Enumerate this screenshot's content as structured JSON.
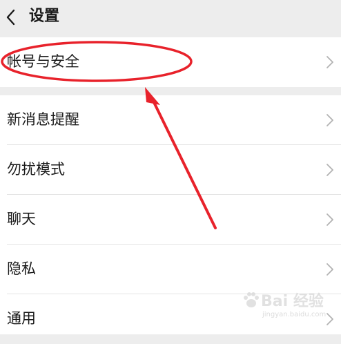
{
  "header": {
    "title": "设置",
    "back_icon": "chevron-left-icon"
  },
  "groups": [
    {
      "items": [
        {
          "label": "帐号与安全",
          "icon": "chevron-right-icon"
        }
      ]
    },
    {
      "items": [
        {
          "label": "新消息提醒",
          "icon": "chevron-right-icon"
        },
        {
          "label": "勿扰模式",
          "icon": "chevron-right-icon"
        },
        {
          "label": "聊天",
          "icon": "chevron-right-icon"
        },
        {
          "label": "隐私",
          "icon": "chevron-right-icon"
        },
        {
          "label": "通用",
          "icon": "chevron-right-icon"
        }
      ]
    }
  ],
  "annotation": {
    "color": "#e8222b",
    "shapes": [
      "ellipse",
      "arrow"
    ]
  },
  "watermark": {
    "text": "Bai 经验",
    "sub": "jingyan.baidu.com"
  },
  "colors": {
    "background": "#ededed",
    "surface": "#ffffff",
    "text": "#1a1a1a",
    "chevron": "#b2b2b2",
    "annotation": "#e8222b"
  }
}
